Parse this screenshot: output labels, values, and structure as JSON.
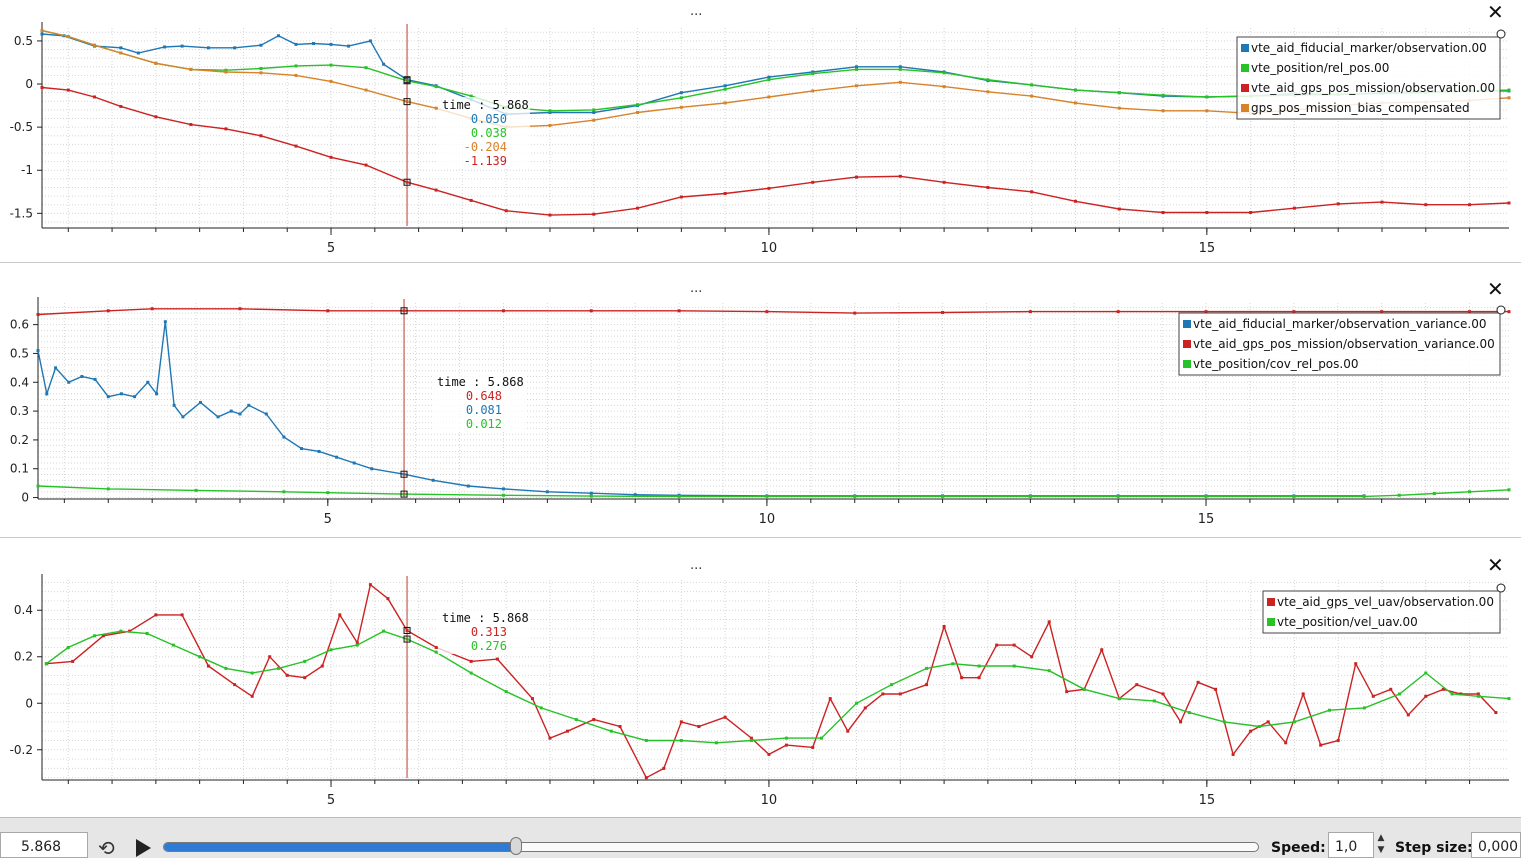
{
  "colors": {
    "blue": "#1f77b4",
    "green": "#27c227",
    "red": "#cc2222",
    "orange": "#d8822a"
  },
  "panels": [
    {
      "menu_label": "...",
      "close_label": "✕",
      "chart_data": {
        "type": "line",
        "xlim": [
          1.7,
          18.45
        ],
        "ylim": [
          -1.67,
          0.65
        ],
        "yticks": [
          0.5,
          0,
          -0.5,
          -1,
          -1.5
        ],
        "ytick_labels": [
          "0.5",
          "0",
          "-0.5",
          "-1",
          "-1.5"
        ],
        "xticks": [
          5,
          10,
          15
        ],
        "xtick_labels": [
          "5",
          "10",
          "15"
        ],
        "cursor_x": 5.868,
        "tracker": {
          "label": "time : 5.868",
          "values": [
            "0.050",
            "0.038",
            "-0.204",
            "-1.139"
          ]
        },
        "legend_position": "top-right",
        "series": [
          {
            "name": "vte_aid_fiducial_marker/observation.00",
            "color": "blue",
            "x": [
              1.7,
              1.95,
              2.3,
              2.6,
              2.8,
              3.1,
              3.3,
              3.6,
              3.9,
              4.2,
              4.4,
              4.6,
              4.8,
              5.0,
              5.2,
              5.45,
              5.6,
              5.868,
              6.2,
              6.6,
              7.0,
              7.5,
              8.0,
              8.5,
              9.0,
              9.5,
              10.0,
              10.5,
              11.0,
              11.5,
              12.0,
              12.5,
              13.0,
              13.5,
              14.0,
              14.5,
              15.0,
              15.5,
              16.0,
              16.5,
              17.0,
              17.5,
              18.0,
              18.45
            ],
            "y": [
              0.58,
              0.56,
              0.44,
              0.42,
              0.36,
              0.43,
              0.44,
              0.42,
              0.42,
              0.45,
              0.56,
              0.46,
              0.47,
              0.46,
              0.44,
              0.5,
              0.23,
              0.05,
              -0.02,
              -0.18,
              -0.35,
              -0.33,
              -0.33,
              -0.25,
              -0.1,
              -0.02,
              0.08,
              0.14,
              0.2,
              0.2,
              0.14,
              0.04,
              -0.01,
              -0.07,
              -0.1,
              -0.14,
              -0.15,
              -0.14,
              -0.11,
              -0.12,
              -0.1,
              -0.09,
              -0.08,
              -0.08
            ]
          },
          {
            "name": "vte_position/rel_pos.00",
            "color": "green",
            "x": [
              1.7,
              2.0,
              2.3,
              2.6,
              3.0,
              3.4,
              3.8,
              4.2,
              4.6,
              5.0,
              5.4,
              5.868,
              6.2,
              6.6,
              7.0,
              7.5,
              8.0,
              8.5,
              9.0,
              9.5,
              10.0,
              10.5,
              11.0,
              11.5,
              12.0,
              12.5,
              13.0,
              13.5,
              14.0,
              14.5,
              15.0,
              15.5,
              16.0,
              16.5,
              17.0,
              17.5,
              18.0,
              18.45
            ],
            "y": [
              0.62,
              0.55,
              0.45,
              0.36,
              0.24,
              0.17,
              0.16,
              0.18,
              0.21,
              0.22,
              0.19,
              0.038,
              -0.03,
              -0.14,
              -0.27,
              -0.31,
              -0.3,
              -0.24,
              -0.16,
              -0.06,
              0.05,
              0.12,
              0.17,
              0.17,
              0.13,
              0.05,
              -0.01,
              -0.07,
              -0.1,
              -0.13,
              -0.15,
              -0.14,
              -0.13,
              -0.12,
              -0.11,
              -0.1,
              -0.08,
              -0.07
            ]
          },
          {
            "name": "vte_aid_gps_pos_mission/observation.00",
            "color": "red",
            "x": [
              1.7,
              2.0,
              2.3,
              2.6,
              3.0,
              3.4,
              3.8,
              4.2,
              4.6,
              5.0,
              5.4,
              5.868,
              6.2,
              6.6,
              7.0,
              7.5,
              8.0,
              8.5,
              9.0,
              9.5,
              10.0,
              10.5,
              11.0,
              11.5,
              12.0,
              12.5,
              13.0,
              13.5,
              14.0,
              14.5,
              15.0,
              15.5,
              16.0,
              16.5,
              17.0,
              17.5,
              18.0,
              18.45
            ],
            "y": [
              -0.04,
              -0.07,
              -0.15,
              -0.26,
              -0.38,
              -0.47,
              -0.52,
              -0.6,
              -0.72,
              -0.85,
              -0.94,
              -1.139,
              -1.23,
              -1.35,
              -1.47,
              -1.52,
              -1.51,
              -1.44,
              -1.31,
              -1.27,
              -1.21,
              -1.14,
              -1.08,
              -1.07,
              -1.14,
              -1.2,
              -1.25,
              -1.36,
              -1.45,
              -1.49,
              -1.49,
              -1.49,
              -1.44,
              -1.39,
              -1.37,
              -1.4,
              -1.4,
              -1.38
            ]
          },
          {
            "name": "gps_pos_mission_bias_compensated",
            "color": "orange",
            "x": [
              1.7,
              2.0,
              2.3,
              2.6,
              3.0,
              3.4,
              3.8,
              4.2,
              4.6,
              5.0,
              5.4,
              5.868,
              6.2,
              6.6,
              7.0,
              7.5,
              8.0,
              8.5,
              9.0,
              9.5,
              10.0,
              10.5,
              11.0,
              11.5,
              12.0,
              12.5,
              13.0,
              13.5,
              14.0,
              14.5,
              15.0,
              15.5,
              16.0,
              16.5,
              17.0,
              17.5,
              18.0,
              18.45
            ],
            "y": [
              0.62,
              0.55,
              0.45,
              0.36,
              0.24,
              0.17,
              0.14,
              0.13,
              0.1,
              0.03,
              -0.07,
              -0.204,
              -0.28,
              -0.4,
              -0.5,
              -0.48,
              -0.42,
              -0.33,
              -0.27,
              -0.22,
              -0.15,
              -0.08,
              -0.02,
              0.02,
              -0.03,
              -0.09,
              -0.14,
              -0.22,
              -0.28,
              -0.31,
              -0.31,
              -0.34,
              -0.3,
              -0.25,
              -0.22,
              -0.21,
              -0.19,
              -0.16
            ]
          }
        ]
      }
    },
    {
      "menu_label": "...",
      "close_label": "✕",
      "chart_data": {
        "type": "line",
        "xlim": [
          1.7,
          18.45
        ],
        "ylim": [
          -0.005,
          0.675
        ],
        "yticks": [
          0.6,
          0.5,
          0.4,
          0.3,
          0.2,
          0.1,
          0
        ],
        "ytick_labels": [
          "0.6",
          "0.5",
          "0.4",
          "0.3",
          "0.2",
          "0.1",
          "0"
        ],
        "xticks": [
          5,
          10,
          15
        ],
        "xtick_labels": [
          "5",
          "10",
          "15"
        ],
        "cursor_x": 5.868,
        "tracker": {
          "label": "time : 5.868",
          "values": [
            "0.648",
            "0.081",
            "0.012"
          ]
        },
        "legend_position": "top-right",
        "series": [
          {
            "name": "vte_aid_fiducial_marker/observation_variance.00",
            "color": "blue",
            "x": [
              1.7,
              1.8,
              1.9,
              2.05,
              2.2,
              2.35,
              2.5,
              2.65,
              2.8,
              2.95,
              3.05,
              3.15,
              3.25,
              3.35,
              3.55,
              3.75,
              3.9,
              4.0,
              4.1,
              4.3,
              4.5,
              4.7,
              4.9,
              5.1,
              5.3,
              5.5,
              5.868,
              6.2,
              6.6,
              7.0,
              7.5,
              8.0,
              8.5,
              9.0,
              10.0,
              11.0,
              12.0,
              13.0,
              14.0,
              15.0,
              16.0,
              16.8
            ],
            "y": [
              0.51,
              0.36,
              0.45,
              0.4,
              0.42,
              0.41,
              0.35,
              0.36,
              0.35,
              0.4,
              0.36,
              0.61,
              0.32,
              0.28,
              0.33,
              0.28,
              0.3,
              0.29,
              0.32,
              0.29,
              0.21,
              0.17,
              0.16,
              0.14,
              0.12,
              0.1,
              0.081,
              0.06,
              0.04,
              0.03,
              0.02,
              0.015,
              0.01,
              0.008,
              0.006,
              0.006,
              0.006,
              0.006,
              0.006,
              0.006,
              0.006,
              0.006
            ]
          },
          {
            "name": "vte_aid_gps_pos_mission/observation_variance.00",
            "color": "red",
            "x": [
              1.7,
              2.5,
              3.0,
              4.0,
              5.0,
              5.868,
              7.0,
              8.0,
              9.0,
              10.0,
              11.0,
              12.0,
              13.0,
              14.0,
              15.0,
              16.0,
              17.0,
              18.0,
              18.45
            ],
            "y": [
              0.635,
              0.648,
              0.655,
              0.655,
              0.648,
              0.648,
              0.648,
              0.648,
              0.648,
              0.645,
              0.64,
              0.642,
              0.645,
              0.645,
              0.645,
              0.645,
              0.645,
              0.645,
              0.645
            ]
          },
          {
            "name": "vte_position/cov_rel_pos.00",
            "color": "green",
            "x": [
              1.7,
              2.5,
              3.5,
              4.5,
              5.0,
              5.868,
              7.0,
              8.0,
              9.0,
              10.0,
              11.0,
              12.0,
              13.0,
              14.0,
              15.0,
              16.0,
              16.8,
              17.2,
              17.6,
              18.0,
              18.45
            ],
            "y": [
              0.04,
              0.03,
              0.025,
              0.02,
              0.017,
              0.012,
              0.008,
              0.005,
              0.004,
              0.004,
              0.004,
              0.004,
              0.004,
              0.004,
              0.004,
              0.004,
              0.004,
              0.008,
              0.014,
              0.02,
              0.027
            ]
          }
        ]
      }
    },
    {
      "menu_label": "...",
      "close_label": "✕",
      "chart_data": {
        "type": "line",
        "xlim": [
          1.7,
          18.45
        ],
        "ylim": [
          -0.33,
          0.53
        ],
        "yticks": [
          0.4,
          0.2,
          0,
          -0.2
        ],
        "ytick_labels": [
          "0.4",
          "0.2",
          "0",
          "-0.2"
        ],
        "xticks": [
          5,
          10,
          15
        ],
        "xtick_labels": [
          "5",
          "10",
          "15"
        ],
        "cursor_x": 5.868,
        "tracker": {
          "label": "time : 5.868",
          "values": [
            "0.313",
            "0.276"
          ]
        },
        "legend_position": "top-right",
        "series": [
          {
            "name": "vte_aid_gps_vel_uav/observation.00",
            "color": "red",
            "x": [
              1.75,
              2.05,
              2.4,
              2.7,
              3.0,
              3.3,
              3.6,
              3.9,
              4.1,
              4.3,
              4.5,
              4.7,
              4.9,
              5.1,
              5.3,
              5.45,
              5.65,
              5.868,
              6.2,
              6.6,
              6.9,
              7.3,
              7.5,
              7.7,
              8.0,
              8.3,
              8.6,
              8.8,
              9.0,
              9.2,
              9.5,
              9.8,
              10.0,
              10.2,
              10.5,
              10.7,
              10.9,
              11.1,
              11.3,
              11.5,
              11.8,
              12.0,
              12.2,
              12.4,
              12.6,
              12.8,
              13.0,
              13.2,
              13.4,
              13.6,
              13.8,
              14.0,
              14.2,
              14.5,
              14.7,
              14.9,
              15.1,
              15.3,
              15.5,
              15.7,
              15.9,
              16.1,
              16.3,
              16.5,
              16.7,
              16.9,
              17.1,
              17.3,
              17.5,
              17.7,
              17.9,
              18.1,
              18.3
            ],
            "y": [
              0.17,
              0.18,
              0.29,
              0.31,
              0.38,
              0.38,
              0.16,
              0.08,
              0.03,
              0.2,
              0.12,
              0.11,
              0.16,
              0.38,
              0.26,
              0.51,
              0.45,
              0.313,
              0.24,
              0.18,
              0.19,
              0.02,
              -0.15,
              -0.12,
              -0.07,
              -0.1,
              -0.32,
              -0.28,
              -0.08,
              -0.1,
              -0.06,
              -0.15,
              -0.22,
              -0.18,
              -0.19,
              0.02,
              -0.12,
              -0.02,
              0.04,
              0.04,
              0.08,
              0.33,
              0.11,
              0.11,
              0.25,
              0.25,
              0.2,
              0.35,
              0.05,
              0.06,
              0.23,
              0.02,
              0.08,
              0.04,
              -0.08,
              0.09,
              0.06,
              -0.22,
              -0.12,
              -0.08,
              -0.17,
              0.04,
              -0.18,
              -0.16,
              0.17,
              0.03,
              0.06,
              -0.05,
              0.03,
              0.06,
              0.04,
              0.04,
              -0.04
            ]
          },
          {
            "name": "vte_position/vel_uav.00",
            "color": "green",
            "x": [
              1.75,
              2.0,
              2.3,
              2.6,
              2.9,
              3.2,
              3.5,
              3.8,
              4.1,
              4.4,
              4.7,
              5.0,
              5.3,
              5.6,
              5.868,
              6.2,
              6.6,
              7.0,
              7.4,
              7.8,
              8.2,
              8.6,
              9.0,
              9.4,
              9.8,
              10.2,
              10.6,
              11.0,
              11.4,
              11.8,
              12.1,
              12.4,
              12.8,
              13.2,
              13.6,
              14.0,
              14.4,
              14.8,
              15.2,
              15.6,
              16.0,
              16.4,
              16.8,
              17.2,
              17.5,
              17.8,
              18.1,
              18.45
            ],
            "y": [
              0.17,
              0.24,
              0.29,
              0.31,
              0.3,
              0.25,
              0.2,
              0.15,
              0.13,
              0.15,
              0.18,
              0.23,
              0.25,
              0.31,
              0.276,
              0.22,
              0.13,
              0.05,
              -0.02,
              -0.07,
              -0.12,
              -0.16,
              -0.16,
              -0.17,
              -0.16,
              -0.15,
              -0.15,
              0.0,
              0.08,
              0.15,
              0.17,
              0.16,
              0.16,
              0.14,
              0.06,
              0.02,
              0.01,
              -0.04,
              -0.08,
              -0.1,
              -0.08,
              -0.03,
              -0.02,
              0.04,
              0.13,
              0.04,
              0.03,
              0.02
            ]
          }
        ]
      }
    }
  ],
  "controls": {
    "time_value": "5.868",
    "loop_icon": "loop-icon",
    "play_icon": "play-icon",
    "progress_fraction": 0.322,
    "speed_label": "Speed:",
    "speed_value": "1,0",
    "step_label": "Step size:",
    "step_value": "0,000"
  }
}
